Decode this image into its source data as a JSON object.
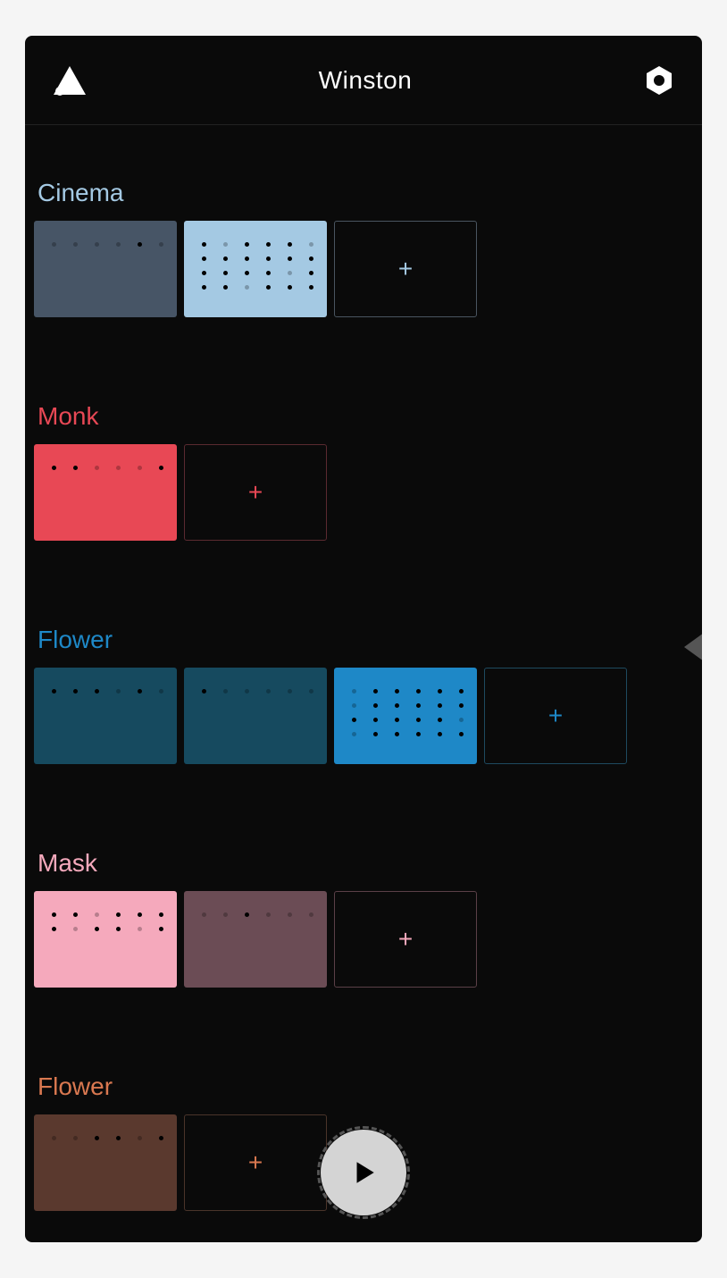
{
  "header": {
    "title": "Winston"
  },
  "tracks": [
    {
      "id": "cinema",
      "title": "Cinema",
      "cssClass": "track-cinema",
      "color": "#a4c9e3",
      "clips": [
        {
          "class": "clip-1",
          "dots": [
            {
              "r": 0,
              "c": 0,
              "a": false
            },
            {
              "r": 0,
              "c": 1,
              "a": false
            },
            {
              "r": 0,
              "c": 2,
              "a": false
            },
            {
              "r": 0,
              "c": 3,
              "a": false
            },
            {
              "r": 0,
              "c": 4,
              "a": true
            },
            {
              "r": 0,
              "c": 5,
              "a": false
            }
          ]
        },
        {
          "class": "clip-2",
          "dots": [
            {
              "r": 0,
              "c": 0,
              "a": true
            },
            {
              "r": 0,
              "c": 1,
              "a": false
            },
            {
              "r": 0,
              "c": 2,
              "a": true
            },
            {
              "r": 0,
              "c": 3,
              "a": true
            },
            {
              "r": 0,
              "c": 4,
              "a": true
            },
            {
              "r": 0,
              "c": 5,
              "a": false
            },
            {
              "r": 1,
              "c": 0,
              "a": true
            },
            {
              "r": 1,
              "c": 1,
              "a": true
            },
            {
              "r": 1,
              "c": 2,
              "a": true
            },
            {
              "r": 1,
              "c": 3,
              "a": true
            },
            {
              "r": 1,
              "c": 4,
              "a": true
            },
            {
              "r": 1,
              "c": 5,
              "a": true
            },
            {
              "r": 2,
              "c": 0,
              "a": true
            },
            {
              "r": 2,
              "c": 1,
              "a": true
            },
            {
              "r": 2,
              "c": 2,
              "a": true
            },
            {
              "r": 2,
              "c": 3,
              "a": true
            },
            {
              "r": 2,
              "c": 4,
              "a": false
            },
            {
              "r": 2,
              "c": 5,
              "a": true
            },
            {
              "r": 3,
              "c": 0,
              "a": true
            },
            {
              "r": 3,
              "c": 1,
              "a": true
            },
            {
              "r": 3,
              "c": 2,
              "a": false
            },
            {
              "r": 3,
              "c": 3,
              "a": true
            },
            {
              "r": 3,
              "c": 4,
              "a": true
            },
            {
              "r": 3,
              "c": 5,
              "a": true
            }
          ]
        }
      ],
      "addBtn": "+"
    },
    {
      "id": "monk",
      "title": "Monk",
      "cssClass": "track-monk",
      "color": "#e84855",
      "clips": [
        {
          "class": "clip-1",
          "dots": [
            {
              "r": 0,
              "c": 0,
              "a": true
            },
            {
              "r": 0,
              "c": 1,
              "a": true
            },
            {
              "r": 0,
              "c": 2,
              "a": false
            },
            {
              "r": 0,
              "c": 3,
              "a": false
            },
            {
              "r": 0,
              "c": 4,
              "a": false
            },
            {
              "r": 0,
              "c": 5,
              "a": true
            }
          ]
        }
      ],
      "addBtn": "+"
    },
    {
      "id": "flower-blue",
      "title": "Flower",
      "cssClass": "track-flower-blue",
      "color": "#1e88c7",
      "clips": [
        {
          "class": "clip-1",
          "dots": [
            {
              "r": 0,
              "c": 0,
              "a": true
            },
            {
              "r": 0,
              "c": 1,
              "a": true
            },
            {
              "r": 0,
              "c": 2,
              "a": true
            },
            {
              "r": 0,
              "c": 3,
              "a": false
            },
            {
              "r": 0,
              "c": 4,
              "a": true
            },
            {
              "r": 0,
              "c": 5,
              "a": false
            }
          ]
        },
        {
          "class": "clip-2",
          "dots": [
            {
              "r": 0,
              "c": 0,
              "a": true
            },
            {
              "r": 0,
              "c": 1,
              "a": false
            },
            {
              "r": 0,
              "c": 2,
              "a": false
            },
            {
              "r": 0,
              "c": 3,
              "a": false
            },
            {
              "r": 0,
              "c": 4,
              "a": false
            },
            {
              "r": 0,
              "c": 5,
              "a": false
            }
          ]
        },
        {
          "class": "clip-3",
          "dots": [
            {
              "r": 0,
              "c": 0,
              "a": false
            },
            {
              "r": 0,
              "c": 1,
              "a": true
            },
            {
              "r": 0,
              "c": 2,
              "a": true
            },
            {
              "r": 0,
              "c": 3,
              "a": true
            },
            {
              "r": 0,
              "c": 4,
              "a": true
            },
            {
              "r": 0,
              "c": 5,
              "a": true
            },
            {
              "r": 1,
              "c": 0,
              "a": false
            },
            {
              "r": 1,
              "c": 1,
              "a": true
            },
            {
              "r": 1,
              "c": 2,
              "a": true
            },
            {
              "r": 1,
              "c": 3,
              "a": true
            },
            {
              "r": 1,
              "c": 4,
              "a": true
            },
            {
              "r": 1,
              "c": 5,
              "a": true
            },
            {
              "r": 2,
              "c": 0,
              "a": true
            },
            {
              "r": 2,
              "c": 1,
              "a": true
            },
            {
              "r": 2,
              "c": 2,
              "a": true
            },
            {
              "r": 2,
              "c": 3,
              "a": true
            },
            {
              "r": 2,
              "c": 4,
              "a": true
            },
            {
              "r": 2,
              "c": 5,
              "a": false
            },
            {
              "r": 3,
              "c": 0,
              "a": false
            },
            {
              "r": 3,
              "c": 1,
              "a": true
            },
            {
              "r": 3,
              "c": 2,
              "a": true
            },
            {
              "r": 3,
              "c": 3,
              "a": true
            },
            {
              "r": 3,
              "c": 4,
              "a": true
            },
            {
              "r": 3,
              "c": 5,
              "a": true
            }
          ]
        }
      ],
      "addBtn": "+"
    },
    {
      "id": "mask",
      "title": "Mask",
      "cssClass": "track-mask",
      "color": "#f5a9bc",
      "clips": [
        {
          "class": "clip-1",
          "dots": [
            {
              "r": 0,
              "c": 0,
              "a": true
            },
            {
              "r": 0,
              "c": 1,
              "a": true
            },
            {
              "r": 0,
              "c": 2,
              "a": false
            },
            {
              "r": 0,
              "c": 3,
              "a": true
            },
            {
              "r": 0,
              "c": 4,
              "a": true
            },
            {
              "r": 0,
              "c": 5,
              "a": true
            },
            {
              "r": 1,
              "c": 0,
              "a": true
            },
            {
              "r": 1,
              "c": 1,
              "a": false
            },
            {
              "r": 1,
              "c": 2,
              "a": true
            },
            {
              "r": 1,
              "c": 3,
              "a": true
            },
            {
              "r": 1,
              "c": 4,
              "a": false
            },
            {
              "r": 1,
              "c": 5,
              "a": true
            }
          ]
        },
        {
          "class": "clip-2",
          "dots": [
            {
              "r": 0,
              "c": 0,
              "a": false
            },
            {
              "r": 0,
              "c": 1,
              "a": false
            },
            {
              "r": 0,
              "c": 2,
              "a": true
            },
            {
              "r": 0,
              "c": 3,
              "a": false
            },
            {
              "r": 0,
              "c": 4,
              "a": false
            },
            {
              "r": 0,
              "c": 5,
              "a": false
            }
          ]
        }
      ],
      "addBtn": "+"
    },
    {
      "id": "flower-orange",
      "title": "Flower",
      "cssClass": "track-flower-orange",
      "color": "#d97850",
      "clips": [
        {
          "class": "clip-1",
          "dots": [
            {
              "r": 0,
              "c": 0,
              "a": false
            },
            {
              "r": 0,
              "c": 1,
              "a": false
            },
            {
              "r": 0,
              "c": 2,
              "a": true
            },
            {
              "r": 0,
              "c": 3,
              "a": true
            },
            {
              "r": 0,
              "c": 4,
              "a": false
            },
            {
              "r": 0,
              "c": 5,
              "a": true
            }
          ]
        }
      ],
      "addBtn": "+"
    }
  ]
}
